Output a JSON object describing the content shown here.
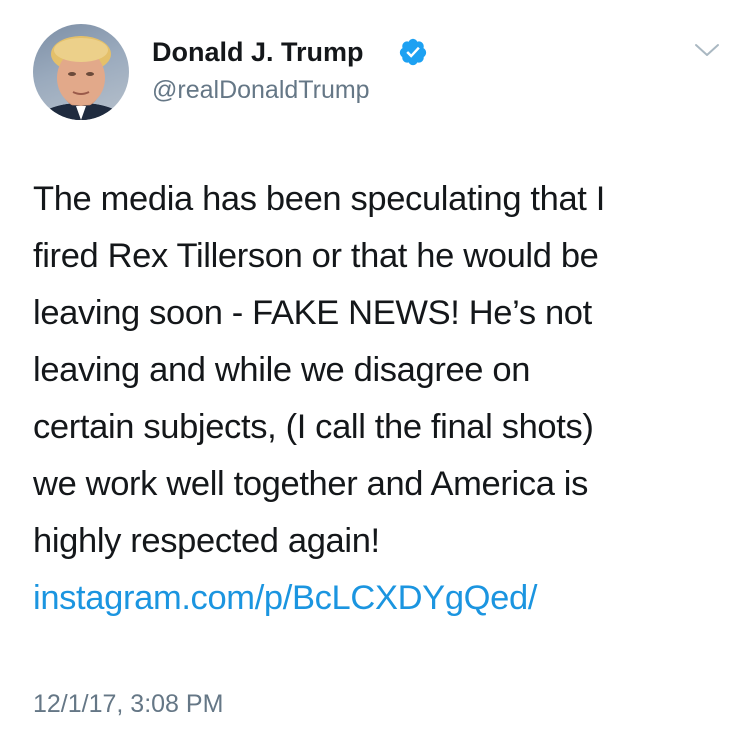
{
  "tweet": {
    "author": {
      "name": "Donald J. Trump",
      "handle": "@realDonaldTrump",
      "verified": true
    },
    "text_lines": [
      "The media has been speculating that I",
      "fired Rex Tillerson or that he would be",
      "leaving soon - FAKE NEWS! He’s not",
      "leaving and while we disagree on",
      "certain subjects, (I call the final shots)",
      "we work well together and America is",
      "highly respected again!"
    ],
    "link": "instagram.com/p/BcLCXDYgQed/",
    "timestamp": "12/1/17, 3:08 PM"
  },
  "colors": {
    "text": "#14171a",
    "secondary": "#657786",
    "link": "#1b95e0",
    "verified_badge": "#1da1f2"
  },
  "icons": {
    "verified": "verified-badge-icon",
    "menu": "chevron-down-icon",
    "avatar": "profile-photo"
  }
}
